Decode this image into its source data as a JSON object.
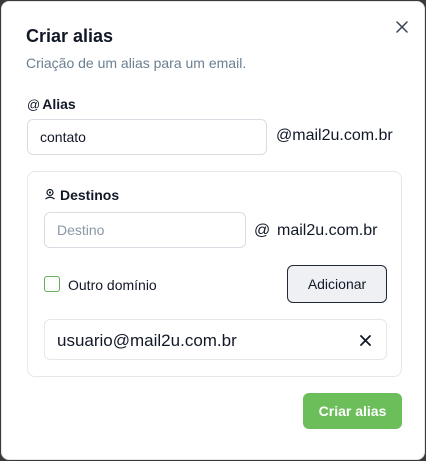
{
  "dialog": {
    "title": "Criar alias",
    "subtitle": "Criação de um alias para um email.",
    "close_icon": "close-icon"
  },
  "alias": {
    "label": "Alias",
    "label_icon": "at-icon",
    "value": "contato",
    "domain": "@mail2u.com.br"
  },
  "destinations": {
    "label": "Destinos",
    "label_icon": "user-pin-icon",
    "input_placeholder": "Destino",
    "input_value": "",
    "at_symbol": "@",
    "domain": "mail2u.com.br",
    "other_domain_label": "Outro domínio",
    "other_domain_checked": false,
    "add_button_label": "Adicionar",
    "items": [
      {
        "email": "usuario@mail2u.com.br",
        "remove_icon": "close-icon"
      }
    ]
  },
  "footer": {
    "create_button_label": "Criar alias"
  },
  "colors": {
    "accent": "#6cbe5a",
    "checkbox_border": "#5fae54",
    "subtitle": "#6a7f91",
    "text": "#111827"
  }
}
